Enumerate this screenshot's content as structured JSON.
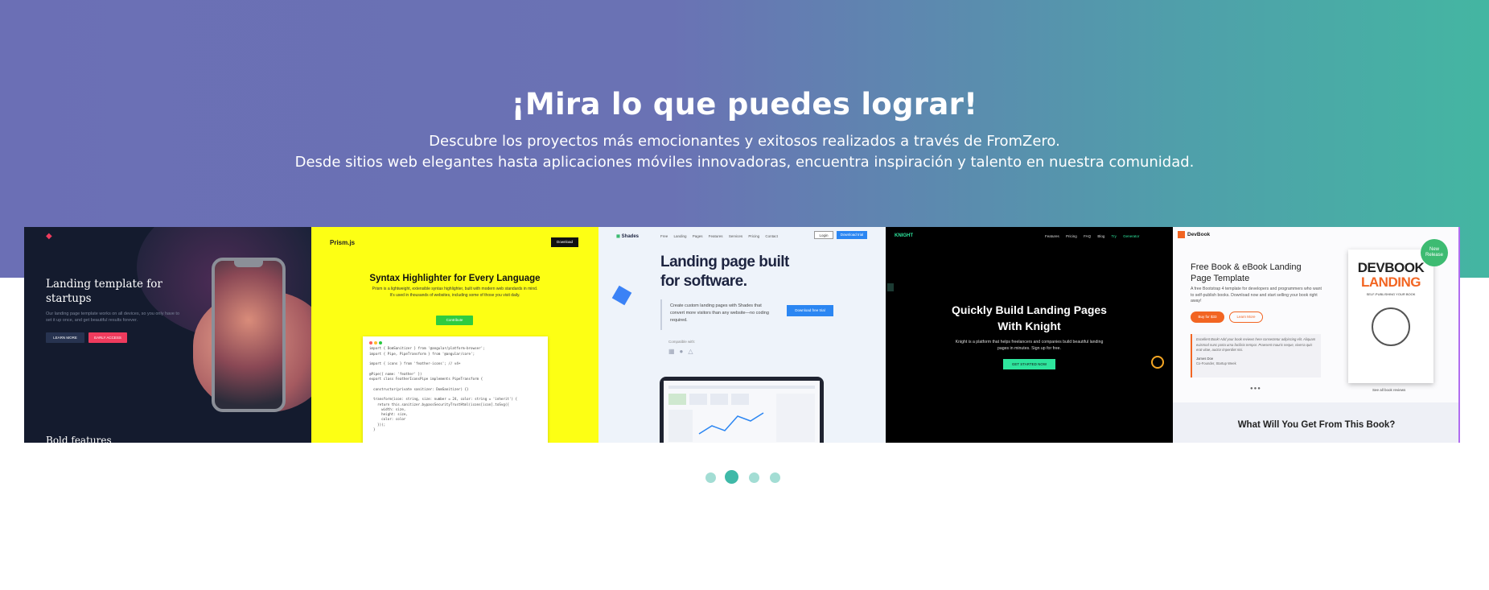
{
  "hero": {
    "title": "¡Mira lo que puedes lograr!",
    "subtitle_line1": "Descubre los proyectos más emocionantes y exitosos realizados a través de FromZero.",
    "subtitle_line2": "Desde sitios web elegantes hasta aplicaciones móviles innovadoras, encuentra inspiración y talento en nuestra comunidad."
  },
  "carousel": {
    "active_index": 1,
    "slides": [
      {
        "title": "Landing template for startups",
        "description": "Our landing page template works on all devices, so you only have to set it up once, and get beautiful results forever.",
        "primary_button": "LEARN MORE",
        "secondary_button": "EARLY ACCESS",
        "footer_heading": "Bold features"
      },
      {
        "logo": "Prism.js",
        "download_button": "Download",
        "title": "Syntax Highlighter for Every Language",
        "description": "Prism is a lightweight, extensible syntax highlighter, built with modern web standards in mind. It's used in thousands of websites, including some of those you visit daily.",
        "cta_button": "Contribute",
        "code_lines": [
          "import { DomSanitizer } from '@angular/platform-browser';",
          "import { Pipe, PipeTransform } from '@angular/core';",
          "",
          "import { icons } from 'feather-icons'; // v4+",
          "",
          "@Pipe({ name: 'feather' })",
          "export class FeatherIconsPipe implements PipeTransform {",
          "",
          "  constructor(private sanitizer: DomSanitizer) {}",
          "",
          "  transform(icon: string, size: number = 24, color: string = 'inherit') {",
          "    return this.sanitizer.bypassSecurityTrustHtml(icons[icon].toSvg({",
          "      width: size,",
          "      height: size,",
          "      color: color",
          "    }));",
          "  }"
        ]
      },
      {
        "logo": "Shades",
        "nav": [
          "Free Landing Pages",
          "Features",
          "Services",
          "Pricing",
          "Contact"
        ],
        "login_button": "Login",
        "try_button": "Download trial",
        "title": "Landing page built for software.",
        "description": "Create custom landing pages with Shades that convert more visitors than any website—no coding required.",
        "cta_button": "Download free trial",
        "compatible_label": "Compatible with:"
      },
      {
        "logo": "KNIGHT",
        "nav": [
          "Features",
          "Pricing",
          "FAQ",
          "Blog"
        ],
        "nav_highlight": "Try Generator",
        "title_line1": "Quickly Build Landing Pages",
        "title_line2": "With Knight",
        "description": "Knight is a platform that helps freelancers and companies build beautiful landing pages in minutes. Sign up for free.",
        "cta_button": "GET STARTED NOW"
      },
      {
        "logo": "DevBook",
        "badge": "New Release",
        "title": "Free Book & eBook Landing Page Template",
        "description": "A free Bootstrap 4 template for developers and programmers who want to self-publish books. Download now and start selling your book right away!",
        "buy_button": "Buy for $33",
        "learn_button": "Learn More",
        "quote": "Excellent Book! Add your book reviews here consectetur adipiscing elit. Aliquam euismod nunc porta urna facilisis tempor. Praesent mauris neque, viverra quis erat vitae, auctor imperdiet nisi.",
        "reviewer_name": "James Doe",
        "reviewer_role": "Co-Founder, Startup Week",
        "book_title_line1": "DEVBOOK",
        "book_title_line2": "LANDING",
        "book_subtitle": "SELF-PUBLISHING YOUR BOOK",
        "see_reviews": "See all book reviews",
        "section_heading": "What Will You Get From This Book?"
      }
    ],
    "dots": 4
  },
  "colors": {
    "hero_gradient_start": "#6b6fb5",
    "hero_gradient_end": "#44b6a2",
    "dot_active": "#3fb9a8",
    "dot_inactive": "#a3ddd4"
  }
}
